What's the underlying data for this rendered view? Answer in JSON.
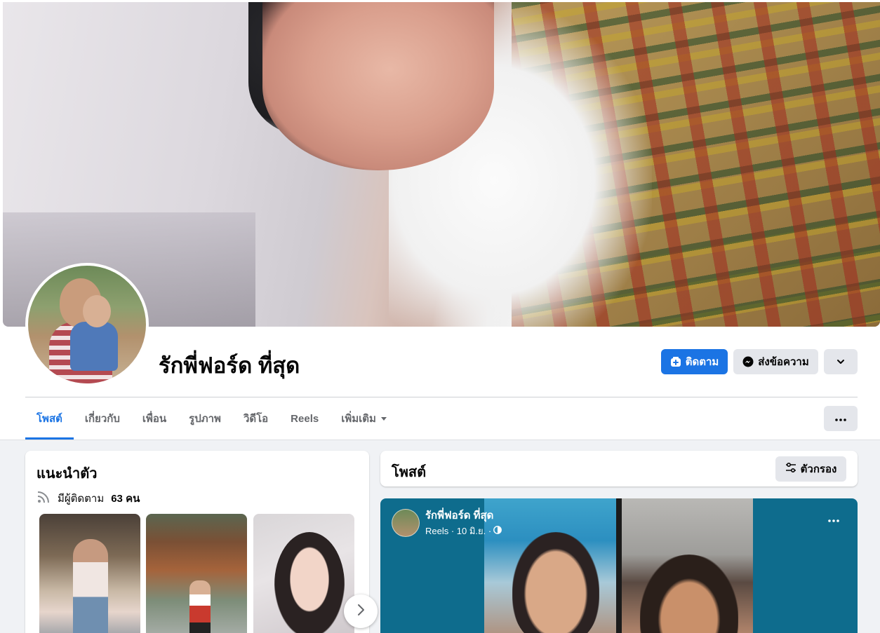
{
  "profile": {
    "name": "รักพี่ฟอร์ด ที่สุด",
    "follow_label": "ติดตาม",
    "message_label": "ส่งข้อความ"
  },
  "tabs": [
    {
      "label": "โพสต์",
      "active": true
    },
    {
      "label": "เกี่ยวกับ"
    },
    {
      "label": "เพื่อน"
    },
    {
      "label": "รูปภาพ"
    },
    {
      "label": "วิดีโอ"
    },
    {
      "label": "Reels"
    },
    {
      "label": "เพิ่มเติม"
    }
  ],
  "intro": {
    "title": "แนะนำตัว",
    "followers_prefix": "มีผู้ติดตาม",
    "followers_count": "63 คน"
  },
  "posts": {
    "title": "โพสต์",
    "filter_label": "ตัวกรอง"
  },
  "reel_post": {
    "author": "รักพี่ฟอร์ด ที่สุด",
    "meta": "Reels · 10 มิ.ย. ·"
  },
  "colors": {
    "accent": "#1b74e4",
    "button_gray": "#e4e6eb",
    "page_bg": "#f0f2f5"
  },
  "icons": [
    "follow-plus-icon",
    "messenger-icon",
    "chevron-down-icon",
    "more-dots-icon",
    "rss-followers-icon",
    "filter-sliders-icon",
    "chevron-right-icon",
    "globe-icon",
    "caret-down-icon"
  ]
}
